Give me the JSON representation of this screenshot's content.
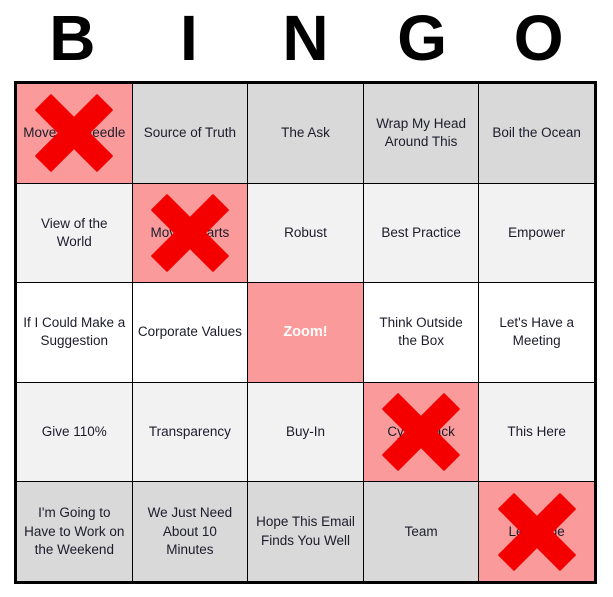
{
  "header": {
    "letters": [
      "B",
      "I",
      "N",
      "G",
      "O"
    ]
  },
  "card": {
    "free_space_label": "Zoom!",
    "marked_icon": "x-mark-icon",
    "colors": {
      "marked_background": "#fb9a9a",
      "marked_x": "#f40000",
      "row_dark": "#d9d9d9",
      "row_light": "#f2f2f2",
      "row_white": "#ffffff",
      "text": "#1c1c2b",
      "free_text": "#ffffff",
      "border": "#000000"
    },
    "rows": [
      {
        "background": "dark",
        "cells": [
          {
            "label": "Move the Needle",
            "marked": true,
            "free": false
          },
          {
            "label": "Source of Truth",
            "marked": false,
            "free": false
          },
          {
            "label": "The Ask",
            "marked": false,
            "free": false
          },
          {
            "label": "Wrap My Head Around This",
            "marked": false,
            "free": false
          },
          {
            "label": "Boil the Ocean",
            "marked": false,
            "free": false
          }
        ]
      },
      {
        "background": "light",
        "cells": [
          {
            "label": "View of the World",
            "marked": false,
            "free": false
          },
          {
            "label": "Moving Parts",
            "marked": true,
            "free": false
          },
          {
            "label": "Robust",
            "marked": false,
            "free": false
          },
          {
            "label": "Best Practice",
            "marked": false,
            "free": false
          },
          {
            "label": "Empower",
            "marked": false,
            "free": false
          }
        ]
      },
      {
        "background": "white",
        "cells": [
          {
            "label": "If I Could Make a Suggestion",
            "marked": false,
            "free": false
          },
          {
            "label": "Corporate Values",
            "marked": false,
            "free": false
          },
          {
            "label": "Zoom!",
            "marked": false,
            "free": true
          },
          {
            "label": "Think Outside the Box",
            "marked": false,
            "free": false
          },
          {
            "label": "Let's Have a Meeting",
            "marked": false,
            "free": false
          }
        ]
      },
      {
        "background": "light",
        "cells": [
          {
            "label": "Give 110%",
            "marked": false,
            "free": false
          },
          {
            "label": "Transparency",
            "marked": false,
            "free": false
          },
          {
            "label": "Buy-In",
            "marked": false,
            "free": false
          },
          {
            "label": "Cycle Back",
            "marked": true,
            "free": false
          },
          {
            "label": "This Here",
            "marked": false,
            "free": false
          }
        ]
      },
      {
        "background": "dark",
        "cells": [
          {
            "label": "I'm Going to Have to Work on the Weekend",
            "marked": false,
            "free": false
          },
          {
            "label": "We Just Need About 10 Minutes",
            "marked": false,
            "free": false
          },
          {
            "label": "Hope This Email Finds You Well",
            "marked": false,
            "free": false
          },
          {
            "label": "Team",
            "marked": false,
            "free": false
          },
          {
            "label": "Leverage",
            "marked": true,
            "free": false
          }
        ]
      }
    ]
  }
}
